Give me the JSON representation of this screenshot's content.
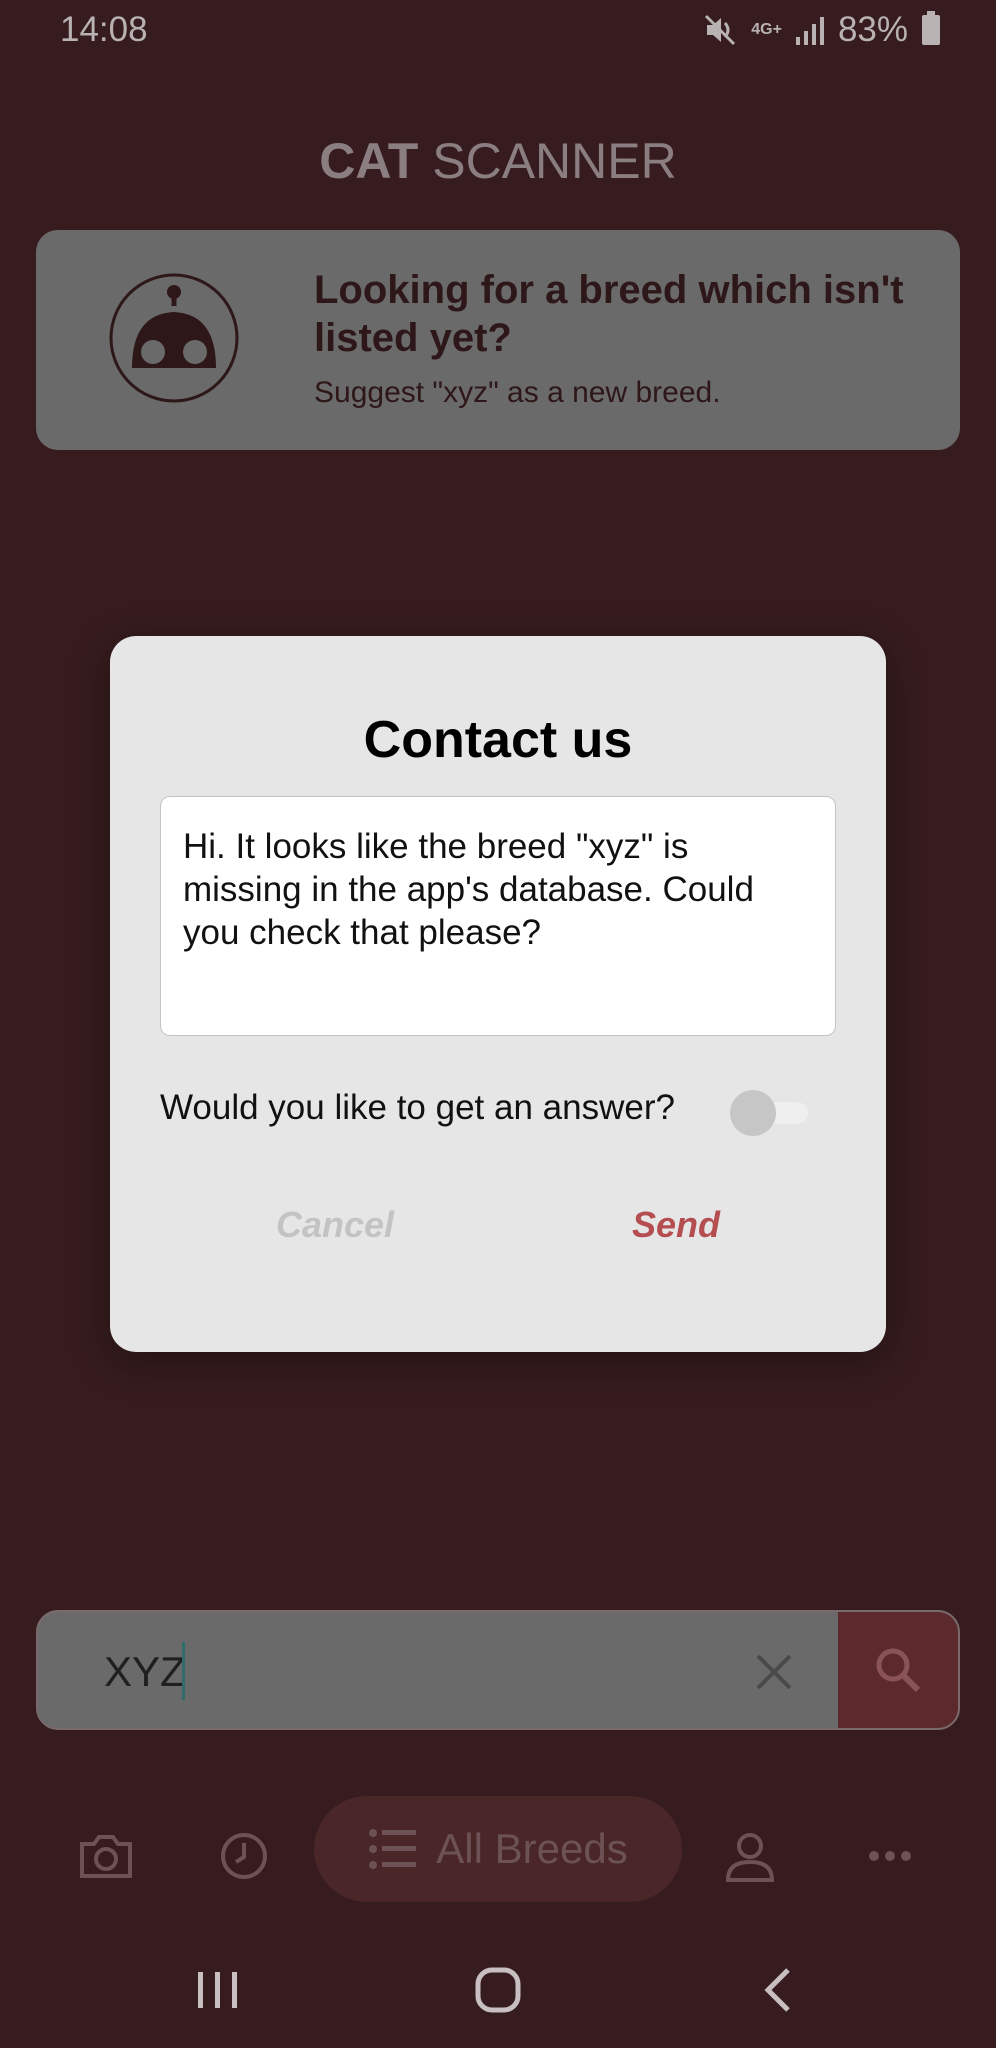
{
  "status_bar": {
    "time": "14:08",
    "network": "4G+",
    "battery": "83%"
  },
  "app": {
    "title_bold": "CAT",
    "title_rest": "SCANNER"
  },
  "suggest_card": {
    "title": "Looking for a breed which isn't listed yet?",
    "subtitle": "Suggest \"xyz\" as a new breed."
  },
  "dialog": {
    "title": "Contact us",
    "message": "Hi. It looks like the breed \"xyz\" is missing in the app's database. Could you check that please?",
    "answer_label": "Would you like to get an answer?",
    "answer_toggle_on": false,
    "cancel_label": "Cancel",
    "send_label": "Send"
  },
  "search": {
    "value": "XYZ"
  },
  "bottom_nav": {
    "active_label": "All Breeds"
  },
  "colors": {
    "background": "#361c1e",
    "accent": "#b54e50",
    "card": "#6a6a6a"
  }
}
